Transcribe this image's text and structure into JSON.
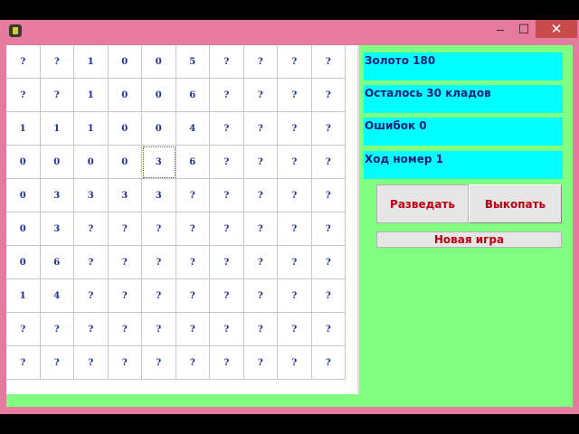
{
  "window": {
    "icon": "app-icon",
    "title_bar_buttons": [
      "minimize",
      "maximize",
      "close"
    ],
    "min_glyph": "–",
    "max_glyph": "☐",
    "close_glyph": "✕"
  },
  "board": {
    "rows": [
      [
        "?",
        "?",
        "1",
        "0",
        "0",
        "5",
        "?",
        "?",
        "?",
        "?"
      ],
      [
        "?",
        "?",
        "1",
        "0",
        "0",
        "6",
        "?",
        "?",
        "?",
        "?"
      ],
      [
        "1",
        "1",
        "1",
        "0",
        "0",
        "4",
        "?",
        "?",
        "?",
        "?"
      ],
      [
        "0",
        "0",
        "0",
        "0",
        "3",
        "6",
        "?",
        "?",
        "?",
        "?"
      ],
      [
        "0",
        "3",
        "3",
        "3",
        "3",
        "?",
        "?",
        "?",
        "?",
        "?"
      ],
      [
        "0",
        "3",
        "?",
        "?",
        "?",
        "?",
        "?",
        "?",
        "?",
        "?"
      ],
      [
        "0",
        "6",
        "?",
        "?",
        "?",
        "?",
        "?",
        "?",
        "?",
        "?"
      ],
      [
        "1",
        "4",
        "?",
        "?",
        "?",
        "?",
        "?",
        "?",
        "?",
        "?"
      ],
      [
        "?",
        "?",
        "?",
        "?",
        "?",
        "?",
        "?",
        "?",
        "?",
        "?"
      ],
      [
        "?",
        "?",
        "?",
        "?",
        "?",
        "?",
        "?",
        "?",
        "?",
        "?"
      ]
    ],
    "selected": {
      "row": 3,
      "col": 4
    }
  },
  "status": {
    "gold": "Золото 180",
    "treasures_left": "Осталось 30 кладов",
    "errors": "Ошибок 0",
    "move": "Ход номер 1"
  },
  "buttons": {
    "scout": "Разведать",
    "dig": "Выкопать",
    "new_game": "Новая игра"
  },
  "colors": {
    "frame": "#e57c9f",
    "client": "#80ff80",
    "info": "#00ffff",
    "cell_text": "#1a2f9e",
    "button_text": "#c0000e"
  }
}
